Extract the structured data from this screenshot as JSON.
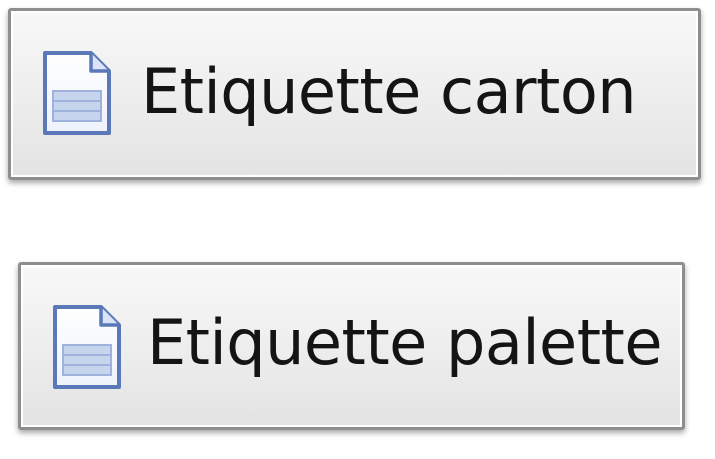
{
  "buttons": [
    {
      "label": "Etiquette carton",
      "icon": "document-icon"
    },
    {
      "label": "Etiquette palette",
      "icon": "document-icon"
    }
  ],
  "colors": {
    "border": "#8e8e8e",
    "icon_outline": "#5b78b8",
    "icon_fill": "#c7d4ee",
    "text": "#141414"
  }
}
